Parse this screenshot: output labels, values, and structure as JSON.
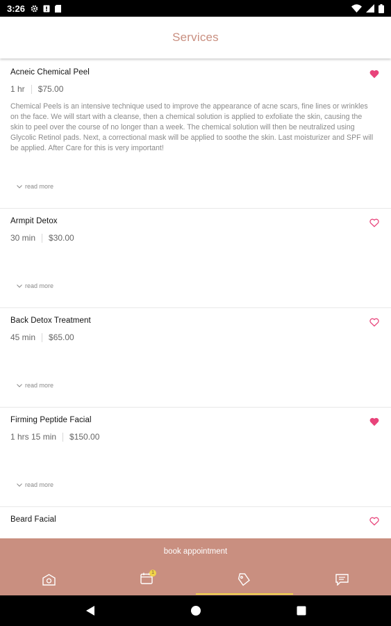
{
  "status_bar": {
    "time": "3:26",
    "icons": [
      "settings-icon",
      "alert-icon",
      "sdcard-icon"
    ],
    "right_icons": [
      "wifi-icon",
      "signal-icon",
      "battery-icon"
    ]
  },
  "header": {
    "title": "Services"
  },
  "colors": {
    "accent": "#c98f80",
    "heart": "#e8437a",
    "active_tab": "#f1d44a"
  },
  "services": [
    {
      "name": "Acneic Chemical Peel",
      "duration": "1 hr",
      "price": "$75.00",
      "favorited": true,
      "description": "Chemical Peels is an intensive technique used to improve the appearance of acne scars, fine lines or wrinkles on the face. We will start with a cleanse, then a chemical solution is applied to exfoliate the skin, causing the skin to peel over the course of no longer than a week. The chemical solution will then be neutralized using Glycolic Retinol pads. Next, a correctional mask will be applied to soothe the skin. Last moisturizer and SPF will be applied. After Care for this is very important!",
      "read_more": "read more"
    },
    {
      "name": "Armpit Detox",
      "duration": "30 min",
      "price": "$30.00",
      "favorited": false,
      "read_more": "read more"
    },
    {
      "name": "Back Detox Treatment",
      "duration": "45 min",
      "price": "$65.00",
      "favorited": false,
      "read_more": "read more"
    },
    {
      "name": "Firming Peptide Facial",
      "duration": "1 hrs 15 min",
      "price": "$150.00",
      "favorited": true,
      "read_more": "read more"
    },
    {
      "name": "Beard Facial",
      "favorited": false
    }
  ],
  "book_button": {
    "label": "book appointment"
  },
  "bottom_nav": {
    "tabs": [
      {
        "icon": "home-icon",
        "active": false
      },
      {
        "icon": "calendar-icon",
        "active": false,
        "badge": "1"
      },
      {
        "icon": "services-tag-icon",
        "active": true
      },
      {
        "icon": "messages-icon",
        "active": false
      }
    ]
  },
  "system_nav": [
    "back-icon",
    "home-circle-icon",
    "recents-icon"
  ]
}
